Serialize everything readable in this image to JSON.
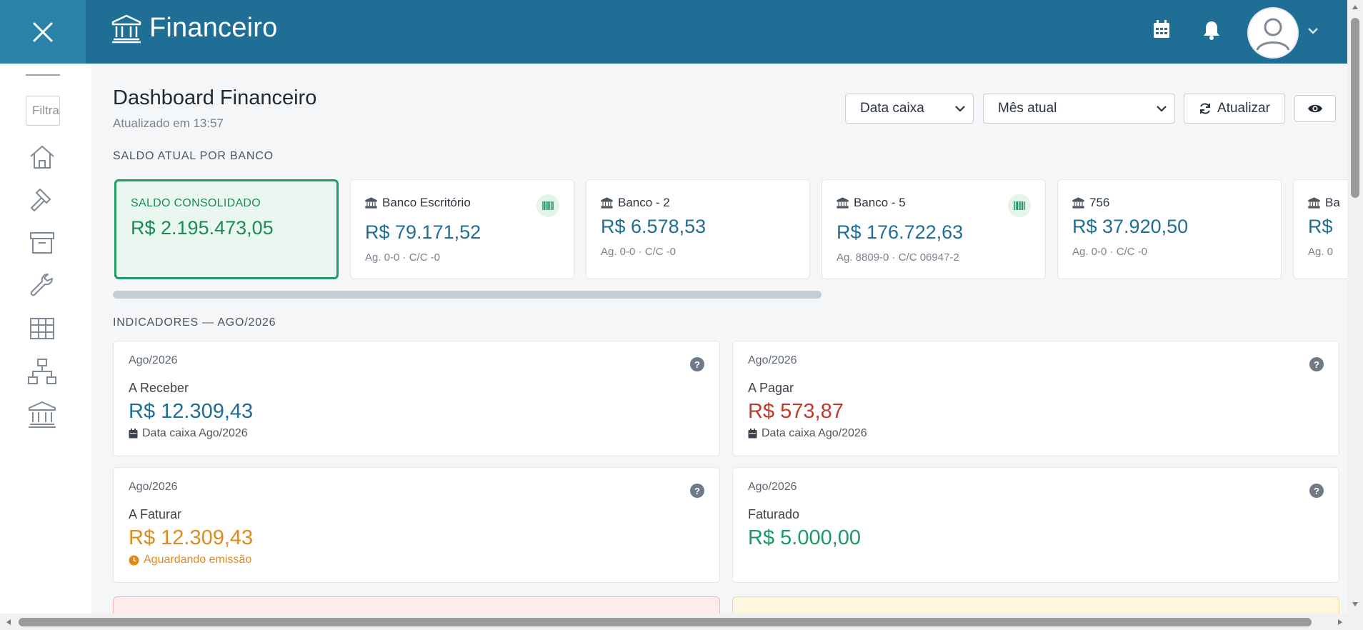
{
  "header": {
    "title": "Financeiro",
    "icons": [
      "close-icon",
      "bank-icon",
      "calendar-icon",
      "bell-icon",
      "user-avatar",
      "chevron-down-icon"
    ]
  },
  "sidebar": {
    "filter_placeholder": "Filtrar",
    "items": [
      "home-icon",
      "gavel-icon",
      "archive-icon",
      "wrench-icon",
      "table-icon",
      "sitemap-icon",
      "bank-icon"
    ]
  },
  "page": {
    "title": "Dashboard Financeiro",
    "subtitle": "Atualizado em 13:57"
  },
  "controls": {
    "date_type": "Data caixa",
    "period": "Mês atual",
    "refresh_label": "Atualizar"
  },
  "banks_section": {
    "label": "SALDO ATUAL POR BANCO",
    "consolidated": {
      "label": "SALDO CONSOLIDADO",
      "amount": "R$ 2.195.473,05"
    },
    "banks": [
      {
        "name": "Banco Escritório",
        "amount": "R$ 79.171,52",
        "detail": "Ag. 0-0 · C/C -0",
        "barcode": true
      },
      {
        "name": "Banco - 2",
        "amount": "R$ 6.578,53",
        "detail": "Ag. 0-0 · C/C -0",
        "barcode": false
      },
      {
        "name": "Banco - 5",
        "amount": "R$ 176.722,63",
        "detail": "Ag. 8809-0 · C/C 06947-2",
        "barcode": true
      },
      {
        "name": "756",
        "amount": "R$ 37.920,50",
        "detail": "Ag. 0-0 · C/C -0",
        "barcode": false
      },
      {
        "name": "Ba",
        "amount": "R$",
        "detail": "Ag. 0",
        "barcode": false
      }
    ]
  },
  "indicators": {
    "label": "INDICADORES — AGO/2026",
    "cards": [
      {
        "period": "Ago/2026",
        "title": "A Receber",
        "value": "R$ 12.309,43",
        "foot": "Data caixa Ago/2026",
        "color": "#1f6e96",
        "foot_color": "#4b5560"
      },
      {
        "period": "Ago/2026",
        "title": "A Pagar",
        "value": "R$ 573,87",
        "foot": "Data caixa Ago/2026",
        "color": "#c0392b",
        "foot_color": "#4b5560"
      },
      {
        "period": "Ago/2026",
        "title": "A Faturar",
        "value": "R$ 12.309,43",
        "foot": "Aguardando emissão",
        "color": "#e08a1e",
        "foot_color": "#e08a1e"
      },
      {
        "period": "Ago/2026",
        "title": "Faturado",
        "value": "R$ 5.000,00",
        "foot": "",
        "color": "#1b9a64",
        "foot_color": "#4b5560"
      }
    ],
    "help": "?"
  },
  "colors": {
    "header_bg": "#1f6e96",
    "close_bg": "#2a82ab",
    "accent_green": "#1f9c66",
    "alert_red_bg": "#fdecea",
    "alert_yellow_bg": "#fff6e0"
  }
}
